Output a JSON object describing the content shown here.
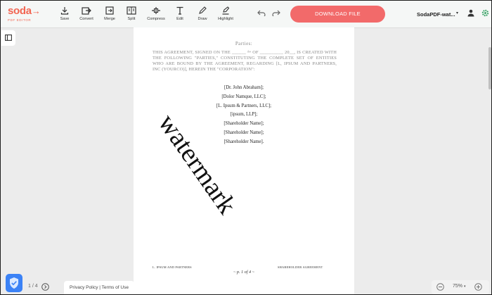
{
  "app": {
    "logo_text": "soda",
    "logo_arrow": "→",
    "logo_sub": "PDF EDITOR",
    "brand_color": "#f26552"
  },
  "toolbar": {
    "tools": [
      {
        "label": "Save",
        "icon": "save-icon"
      },
      {
        "label": "Convert",
        "icon": "convert-icon"
      },
      {
        "label": "Merge",
        "icon": "merge-icon"
      },
      {
        "label": "Split",
        "icon": "split-icon"
      },
      {
        "label": "Compress",
        "icon": "compress-icon"
      },
      {
        "label": "Edit",
        "icon": "text-edit-icon"
      },
      {
        "label": "Draw",
        "icon": "pen-icon"
      },
      {
        "label": "Highlight",
        "icon": "highlight-icon"
      }
    ],
    "download_label": "DOWNLOAD FILE",
    "download_color": "#f26a6a",
    "file_name": "SodaPDF-wat...",
    "caret": "▾"
  },
  "document": {
    "heading": "Parties:",
    "agreement_text": "This Agreement, signed on the ______ ᵗʰᵉ of __________ 20__, is created with the following \"Parties,\" Constituting the complete set of entities who are bound by the Agreement, regarding [L, Ipsum and Partners, INC (yourco)], herein the \"corporation\":",
    "names": [
      "[Dr. John Abraham];",
      "[Dolor Namque, LLC];",
      "[L. Ipsum & Partners, LLC];",
      "[ipsum, LLP];",
      "[Shareholder Name];",
      "[Shareholder Name];",
      "[Shareholder Name]."
    ],
    "watermark": "watermark",
    "footer_left": "L. IPSUM AND PARTNERS",
    "footer_right": "SHAREHOLDER AGREEMENT",
    "page_number": "~ p. 1 of 4 ~"
  },
  "bottom": {
    "pager": "1 / 4",
    "legal": "Privacy Policy | Terms of Use",
    "zoom": "75%",
    "zoom_caret": "▾"
  }
}
